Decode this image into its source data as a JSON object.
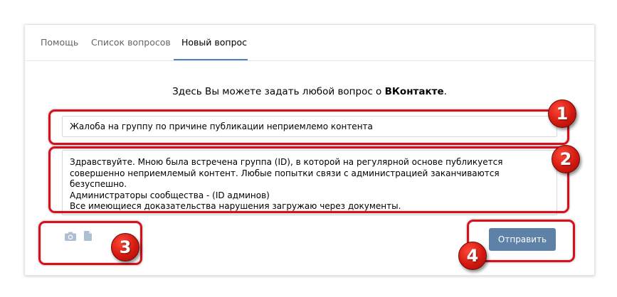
{
  "tabs": [
    {
      "label": "Помощь",
      "active": false
    },
    {
      "label": "Список вопросов",
      "active": false
    },
    {
      "label": "Новый вопрос",
      "active": true
    }
  ],
  "intro": {
    "text": "Здесь Вы можете задать любой вопрос о ",
    "brand": "ВКонтакте",
    "suffix": "."
  },
  "form": {
    "subject_value": "Жалоба на группу по причине публикации неприемлемо контента",
    "body_value": "Здравствуйте. Мною была встречена группа (ID), в которой на регулярной основе публикуется совершенно неприемлемый контент. Любые попытки связи с администрацией заканчиваются безуспешно.\nАдминистраторы сообщества - (ID админов)\nВсе имеющиеся доказательства нарушения загружаю через документы.",
    "attach_icons": [
      "camera-icon",
      "document-icon"
    ],
    "send_label": "Отправить"
  },
  "annotations": [
    "1",
    "2",
    "3",
    "4"
  ],
  "colors": {
    "accent": "#5181b8",
    "button": "#5e81a8",
    "annotation_red": "#d80f1c"
  }
}
